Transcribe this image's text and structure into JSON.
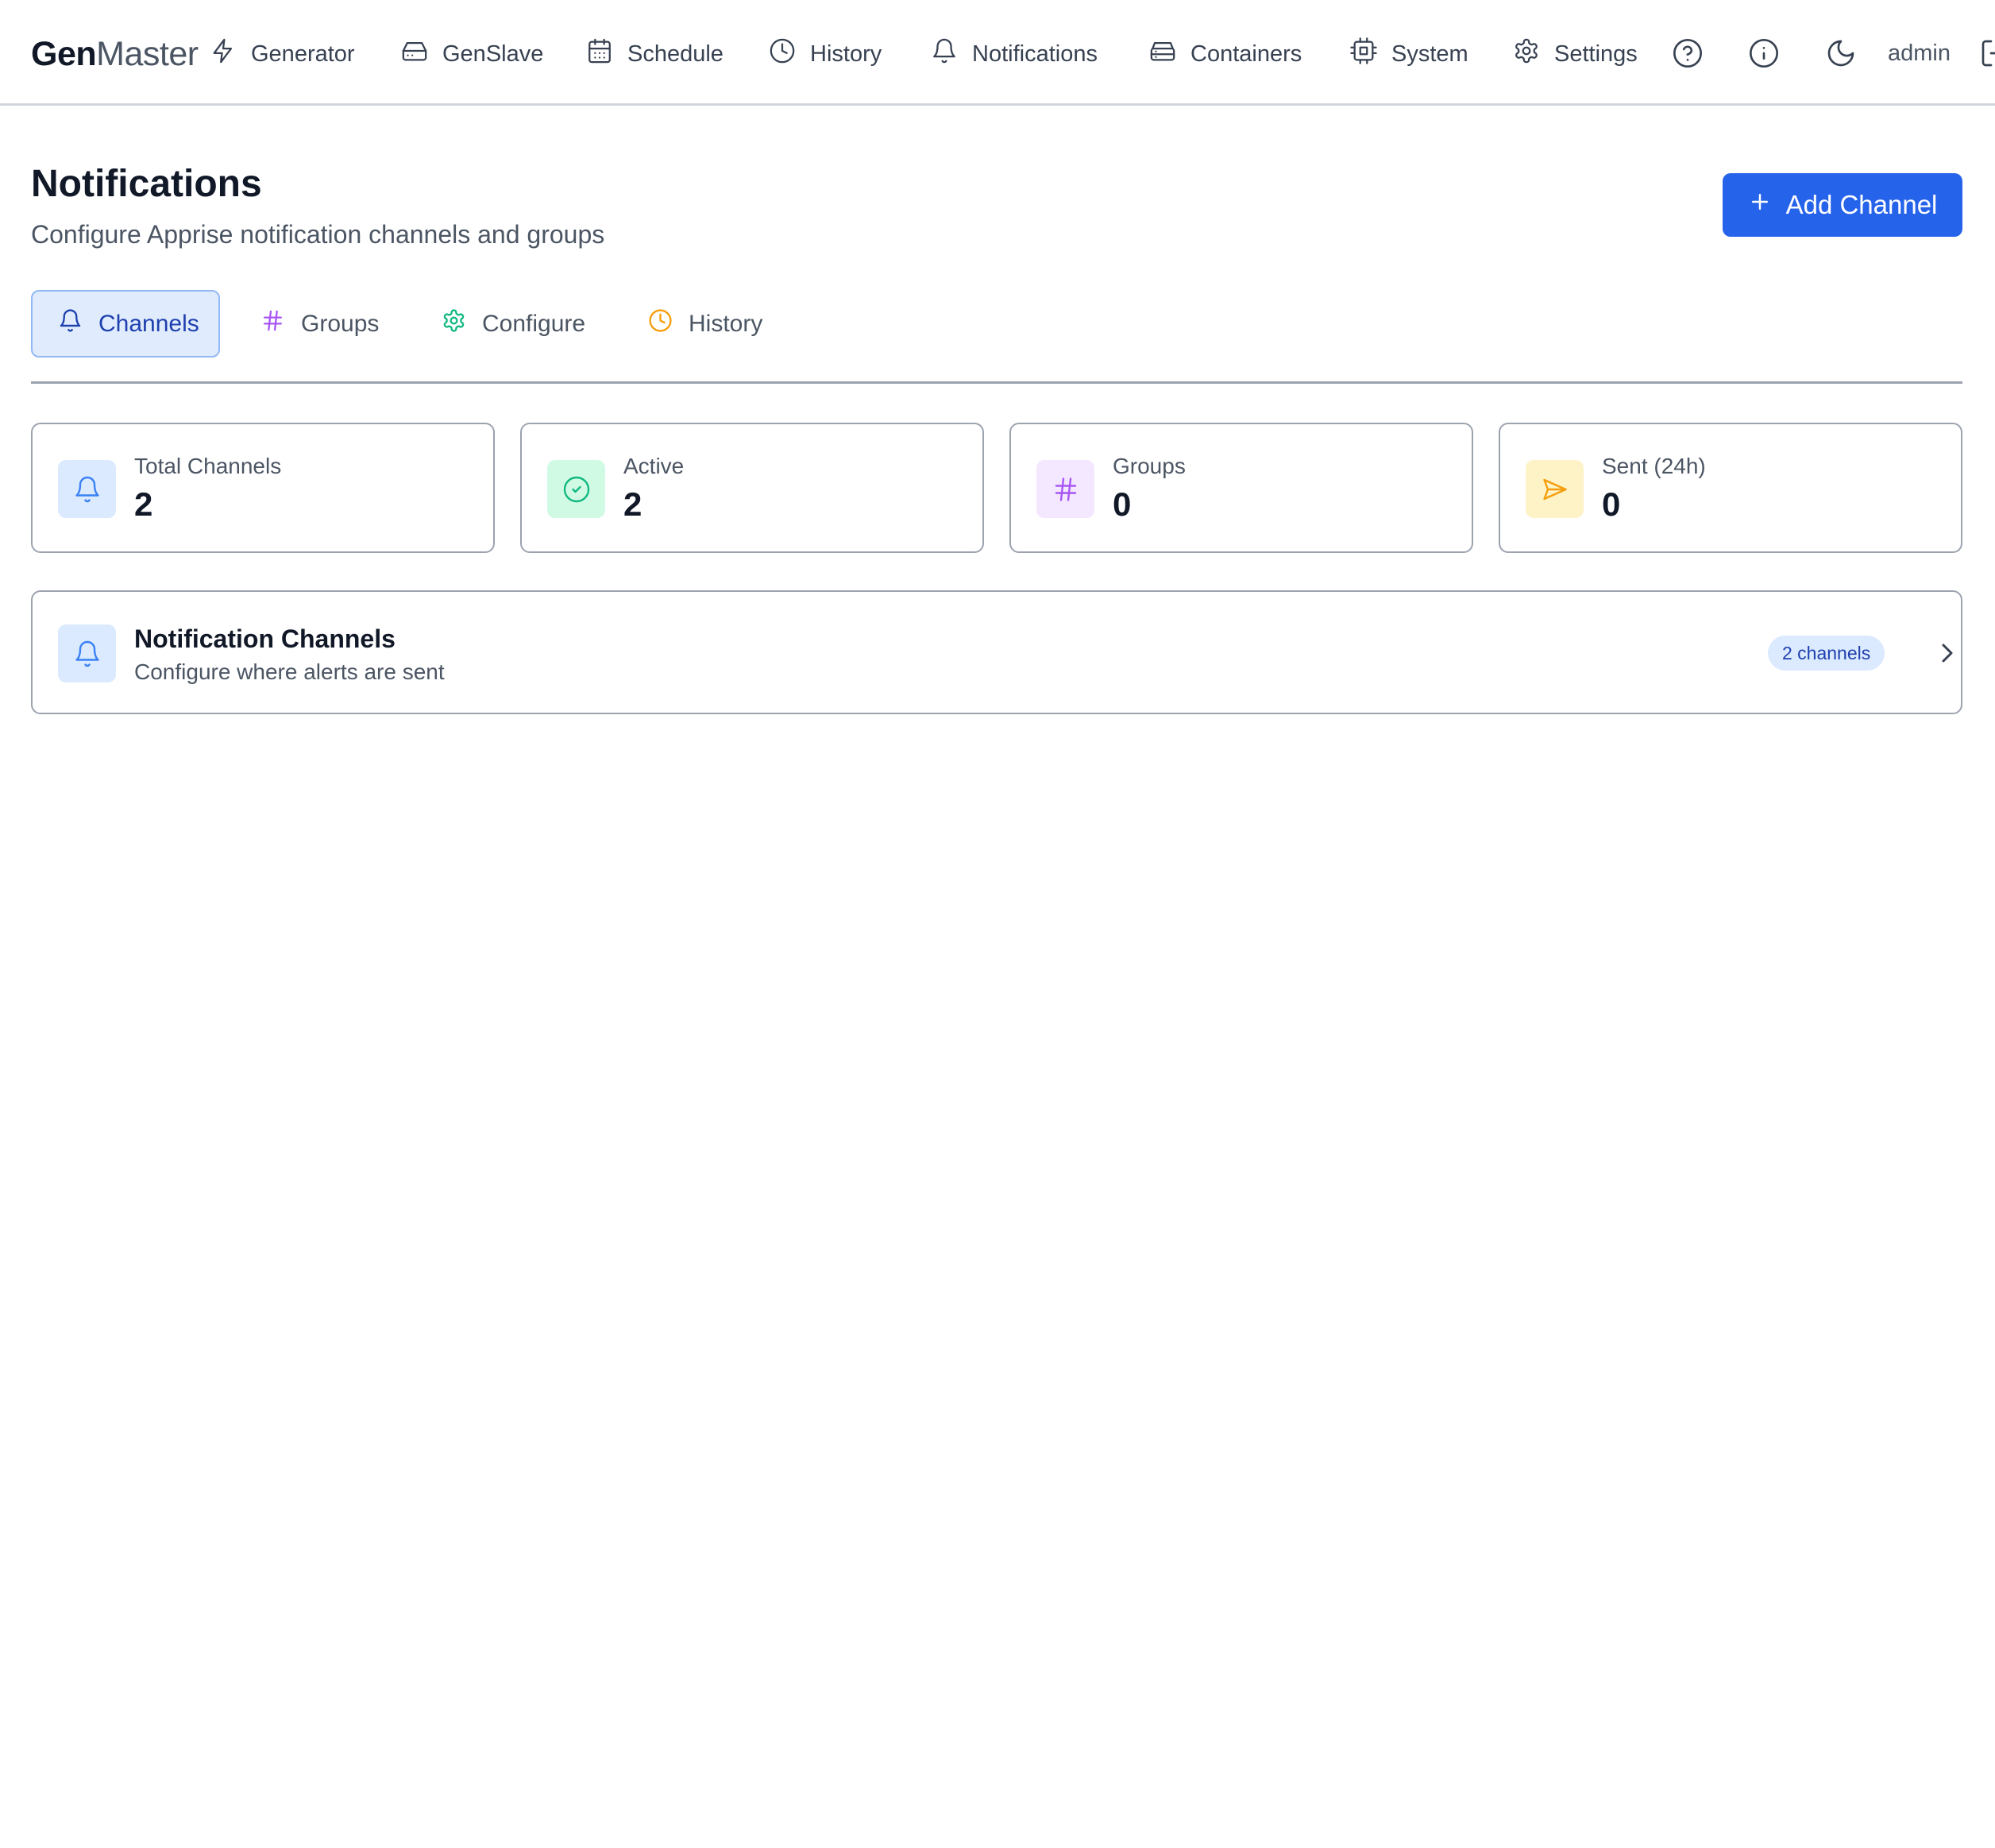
{
  "brand": {
    "first": "Gen",
    "second": "Master"
  },
  "nav": {
    "items": [
      {
        "label": "Generator",
        "icon": "zap-icon"
      },
      {
        "label": "GenSlave",
        "icon": "hard-drive-icon"
      },
      {
        "label": "Schedule",
        "icon": "calendar-icon"
      },
      {
        "label": "History",
        "icon": "clock-icon"
      },
      {
        "label": "Notifications",
        "icon": "bell-icon"
      },
      {
        "label": "Containers",
        "icon": "server-icon"
      },
      {
        "label": "System",
        "icon": "cpu-icon"
      },
      {
        "label": "Settings",
        "icon": "gear-icon"
      }
    ],
    "help_icon": "help-circle-icon",
    "info_icon": "info-icon",
    "theme_icon": "moon-icon",
    "user": "admin",
    "logout_icon": "logout-icon"
  },
  "header": {
    "title": "Notifications",
    "subtitle": "Configure Apprise notification channels and groups",
    "add_button": "Add Channel"
  },
  "tabs": [
    {
      "label": "Channels",
      "icon": "bell-icon",
      "active": true
    },
    {
      "label": "Groups",
      "icon": "hash-icon",
      "active": false
    },
    {
      "label": "Configure",
      "icon": "gear-icon",
      "active": false
    },
    {
      "label": "History",
      "icon": "clock-icon",
      "active": false
    }
  ],
  "stats": [
    {
      "label": "Total Channels",
      "value": "2",
      "icon": "bell-icon",
      "bg": "#dbeafe",
      "color": "#3b82f6"
    },
    {
      "label": "Active",
      "value": "2",
      "icon": "check-circle-icon",
      "bg": "#d1fae5",
      "color": "#10b981"
    },
    {
      "label": "Groups",
      "value": "0",
      "icon": "hash-icon",
      "bg": "#f3e8ff",
      "color": "#a855f7"
    },
    {
      "label": "Sent (24h)",
      "value": "0",
      "icon": "send-icon",
      "bg": "#fef3c7",
      "color": "#f59e0b"
    }
  ],
  "section": {
    "title": "Notification Channels",
    "description": "Configure where alerts are sent",
    "badge": "2 channels"
  },
  "colors": {
    "accent": "#2563eb",
    "text": "#111827",
    "muted": "#4b5563",
    "border": "#9ca3af",
    "active_tab_bg": "#e0ecfd",
    "active_tab_text": "#1e40af"
  }
}
